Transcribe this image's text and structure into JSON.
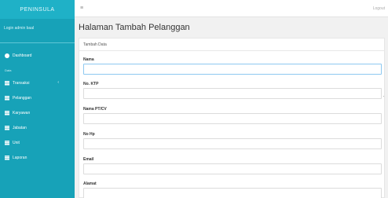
{
  "sidebar": {
    "brand": "PENINSULA",
    "user": "Login admin baal",
    "items": [
      {
        "label": "Dashboard"
      },
      {
        "label": "Transaksi"
      },
      {
        "label": "Pelanggan"
      },
      {
        "label": "Karyawan"
      },
      {
        "label": "Jabatan"
      },
      {
        "label": "Unit"
      },
      {
        "label": "Laporan"
      }
    ],
    "section": "Data"
  },
  "topbar": {
    "toggle": "≡",
    "logout": "Logout"
  },
  "page": {
    "title": "Halaman Tambah Pelanggan"
  },
  "form": {
    "header": "Tambah Data",
    "fields": [
      {
        "label": "Nama",
        "value": ""
      },
      {
        "label": "No. KTP",
        "value": ""
      },
      {
        "label": "Nama PT/CV",
        "value": ""
      },
      {
        "label": "No Hp",
        "value": ""
      },
      {
        "label": "Email",
        "value": ""
      },
      {
        "label": "Alamat",
        "value": ""
      }
    ]
  },
  "colors": {
    "sidebar": "#17a2b8",
    "brand": "#1fb1c7",
    "focus_border": "#8ec9f0"
  }
}
